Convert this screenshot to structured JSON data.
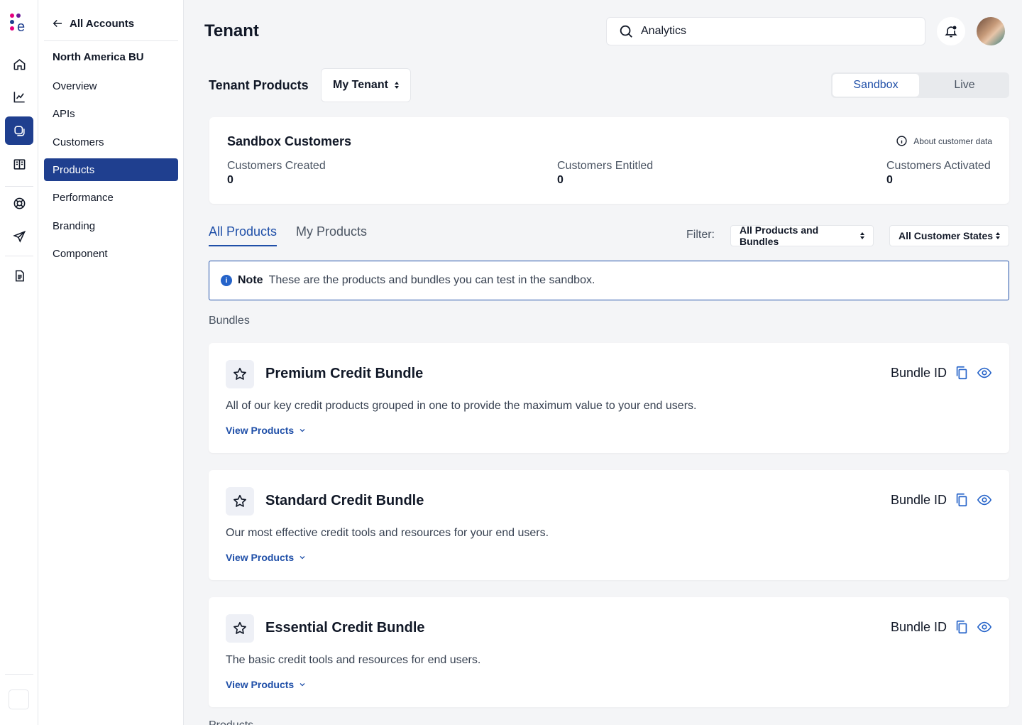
{
  "colors": {
    "accent": "#1f3f8f",
    "link": "#1f4fa8",
    "info": "#2563c9"
  },
  "rail": {
    "icons": [
      "logo-icon",
      "home-icon",
      "chart-icon",
      "products-icon",
      "book-icon",
      "support-icon",
      "send-icon",
      "document-icon"
    ]
  },
  "sidebar": {
    "back_label": "All Accounts",
    "account_name": "North America BU",
    "items": [
      {
        "label": "Overview"
      },
      {
        "label": "APIs"
      },
      {
        "label": "Customers"
      },
      {
        "label": "Products",
        "active": true
      },
      {
        "label": "Performance"
      },
      {
        "label": "Branding"
      },
      {
        "label": "Component"
      }
    ]
  },
  "header": {
    "title": "Tenant",
    "search_value": "Analytics"
  },
  "tenant_products": {
    "label": "Tenant Products",
    "tenant_selected": "My Tenant",
    "env_options": [
      "Sandbox",
      "Live"
    ],
    "env_selected": "Sandbox"
  },
  "sandbox": {
    "title": "Sandbox Customers",
    "about_label": "About customer data",
    "stats": [
      {
        "label": "Customers Created",
        "value": "0"
      },
      {
        "label": "Customers Entitled",
        "value": "0"
      },
      {
        "label": "Customers Activated",
        "value": "0"
      }
    ]
  },
  "tabs": [
    "All Products",
    "My Products"
  ],
  "filters": {
    "label": "Filter:",
    "products_selected": "All Products and Bundles",
    "states_selected": "All Customer States"
  },
  "note": {
    "title": "Note",
    "text": "These are the products and bundles you can test in the sandbox."
  },
  "bundles_label": "Bundles",
  "bundles": [
    {
      "name": "Premium Credit Bundle",
      "id_label": "Bundle ID",
      "description": "All of our key credit products grouped in one to provide the maximum value to your end users.",
      "view_label": "View Products"
    },
    {
      "name": "Standard Credit Bundle",
      "id_label": "Bundle ID",
      "description": "Our most effective credit tools and resources for your end users.",
      "view_label": "View Products"
    },
    {
      "name": "Essential Credit Bundle",
      "id_label": "Bundle ID",
      "description": "The basic credit tools and resources for end users.",
      "view_label": "View Products"
    }
  ],
  "products_label": "Products"
}
